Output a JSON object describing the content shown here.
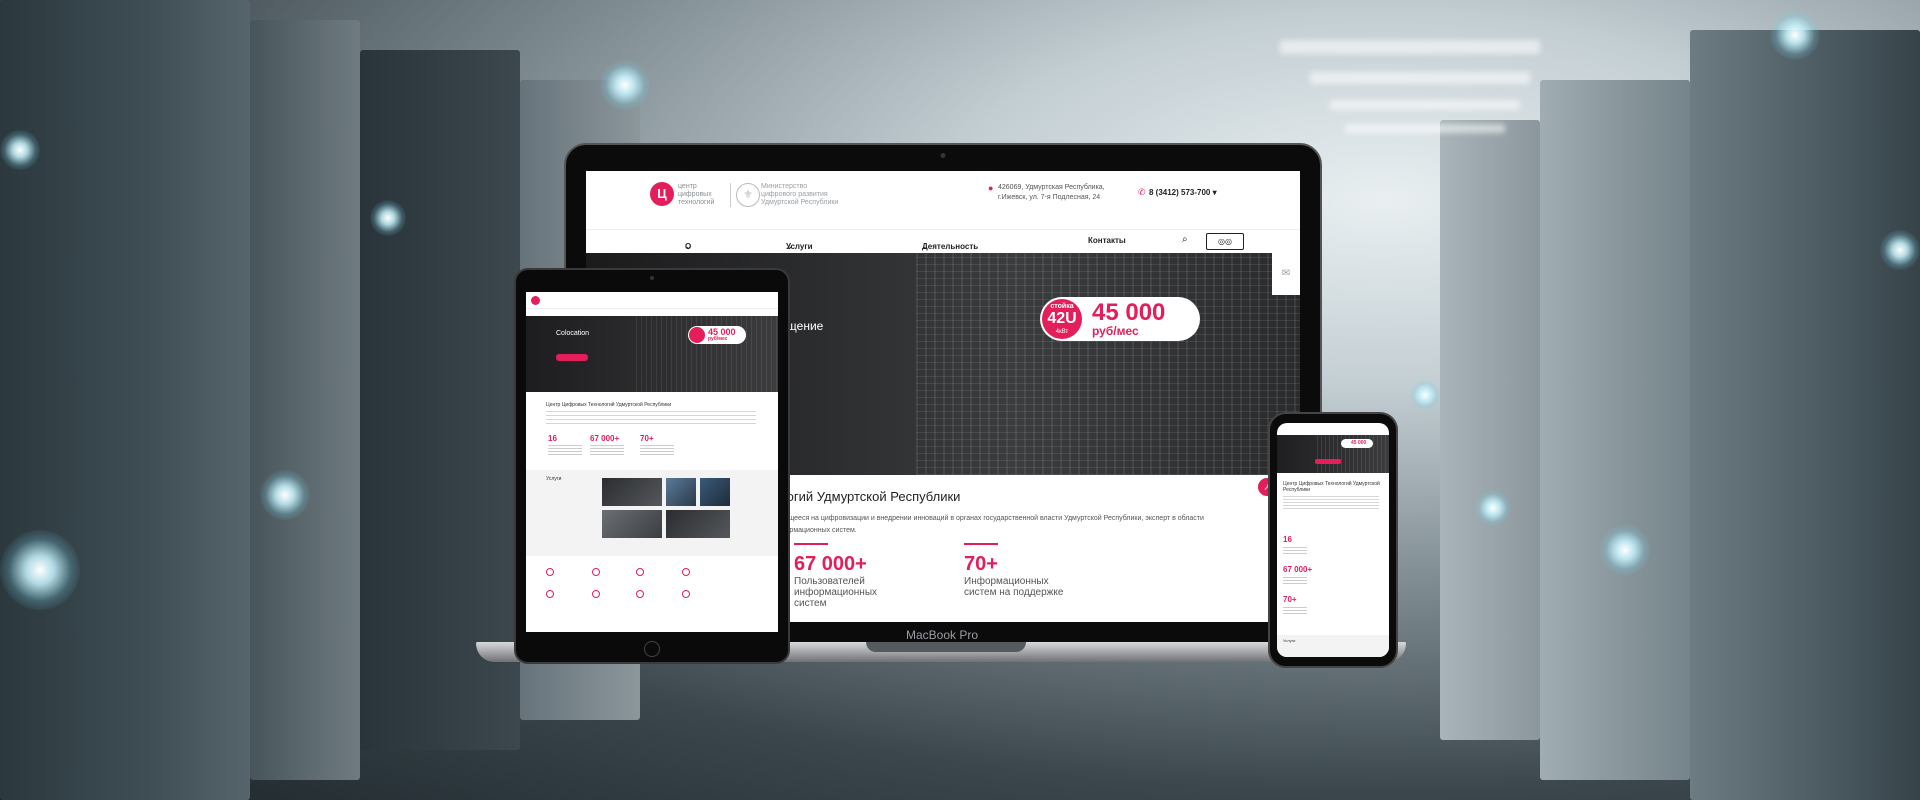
{
  "laptop": {
    "model_label": "MacBook Pro",
    "header": {
      "logo_letter": "Ц",
      "logo_text": "центр цифровых технологий",
      "ministry_text": "Министерство цифрового развития Удмуртской Республики",
      "address": "426069, Удмуртская Республика, г.Ижевск, ул. 7-я Подлесная, 24",
      "phone": "8 (3412) 573-700"
    },
    "nav": [
      {
        "label": "О нас",
        "icon": "chevron-down-icon"
      },
      {
        "label": "Услуги",
        "icon": "chevron-down-icon"
      },
      {
        "label": "Деятельность",
        "icon": "chevron-down-icon"
      },
      {
        "label": "Контакты"
      }
    ],
    "hero": {
      "title": "мещение",
      "price_badge": {
        "line1": "стойка",
        "line2": "42U",
        "line3": "4кВт",
        "amount": "45 000",
        "unit": "руб/мес"
      }
    },
    "about": {
      "title": "ологий Удмуртской Республики",
      "text": "ирующееся на цифровизации и внедрении инноваций в органах государственной власти Удмуртской Республики, эксперт в области информационных систем."
    },
    "stats": [
      {
        "value": "67 000+",
        "label": "Пользователей информационных систем"
      },
      {
        "value": "70+",
        "label": "Информационных систем на поддержке"
      }
    ]
  },
  "tablet": {
    "hero": {
      "title": "Colocation",
      "price_amount": "45 000",
      "price_unit": "руб/мес"
    },
    "about_title": "Центр Цифровых Технологий Удмуртской Республики",
    "stats": [
      {
        "value": "16"
      },
      {
        "value": "67 000+"
      },
      {
        "value": "70+"
      }
    ],
    "services_title": "Услуги"
  },
  "phone": {
    "about_title": "Центр Цифровых Технологий Удмуртской Республики",
    "stats": [
      {
        "value": "16"
      },
      {
        "value": "67 000+"
      },
      {
        "value": "70+"
      }
    ],
    "services_title": "Услуги"
  },
  "colors": {
    "accent": "#e31e5a",
    "dark": "#1d1d1f"
  }
}
